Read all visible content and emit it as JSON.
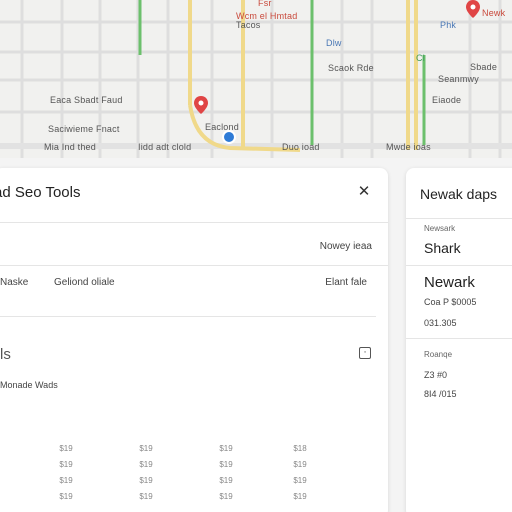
{
  "map": {
    "labels": {
      "top_red": "Fsr",
      "top_red2": "Wcm el Hmtad",
      "right_red": "Newk",
      "blue_1": "Phk",
      "blue_2": "Dlw",
      "green_1": "Cl",
      "street_a": "Eaca Sbadt Faud",
      "street_b": "Saciwieme Fnact",
      "street_c": "Eaclond",
      "street_d": "Scaok Rde",
      "street_e": "Eiaode",
      "street_f": "Seanmwy",
      "street_g": "Sbade",
      "street_h": "Tacos"
    },
    "bottom_labels": [
      "Mia Ind thed",
      "Iidd adt clold",
      "Duo ioad",
      "Mwde ioas"
    ],
    "colors": {
      "road_yellow": "#f0d98a",
      "road_green": "#6cc06c",
      "pin_red": "#e04545",
      "pin_blue": "#2e7bd6"
    }
  },
  "left_panel": {
    "title": "ad Seo Tools",
    "close_icon": "✕",
    "header_right": "Nowey ieaa",
    "row": {
      "left": "Naske",
      "mid": "Geliond oliale",
      "right": "Elant fale"
    },
    "section_title": "ls",
    "sub_label": "Monade Wads",
    "grid": {
      "headers": [
        "",
        "",
        "",
        ""
      ],
      "rows": [
        [
          "$19",
          "$19",
          "$19",
          "$18"
        ],
        [
          "$19",
          "$19",
          "$19",
          "$19"
        ],
        [
          "$19",
          "$19",
          "$19",
          "$19"
        ],
        [
          "$19",
          "$19",
          "$19",
          "$19"
        ]
      ]
    }
  },
  "right_panel": {
    "title": "Newak daps",
    "small1": "Newsark",
    "big1": "Shark",
    "big2": "Newark",
    "val1": "Coa P $0005",
    "val2": "031.305",
    "small2": "Roanqe",
    "val3": "Z3 #0",
    "val4": "8I4 /015"
  }
}
